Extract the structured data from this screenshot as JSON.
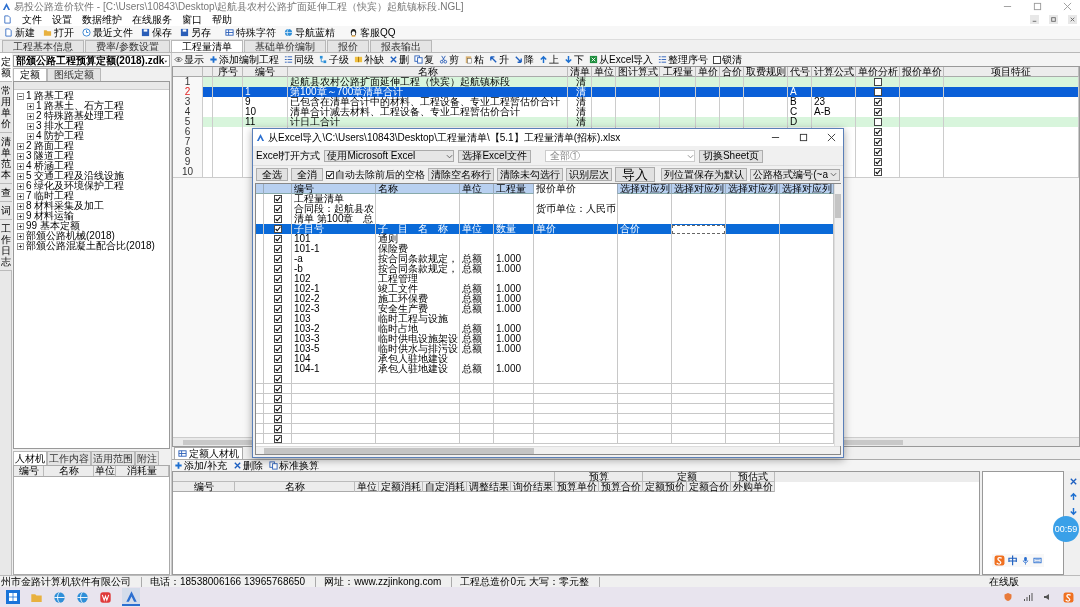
{
  "window": {
    "title": "易投公路造价软件 - [C:\\Users\\10843\\Desktop\\起航县农村公路扩面延伸工程（快宾）起航镇标段.NGL]"
  },
  "menu": [
    "文件",
    "设置",
    "数据维护",
    "在线服务",
    "窗口",
    "帮助"
  ],
  "toolbar": [
    "新建",
    "打开",
    "最近文件",
    "保存",
    "另存",
    "特殊字符",
    "导航蓝精",
    "客服QQ"
  ],
  "tabs": [
    {
      "label": "工程基本信息",
      "selected": false
    },
    {
      "label": "费率/参数设置",
      "selected": false
    },
    {
      "label": "工程量清单",
      "selected": true
    },
    {
      "label": "基础单价编制",
      "selected": false
    },
    {
      "label": "报价",
      "selected": false
    },
    {
      "label": "报表输出",
      "selected": false
    }
  ],
  "side_tabs": [
    {
      "label": "定额",
      "selected": true
    },
    {
      "label": "常用单价",
      "selected": false
    },
    {
      "label": "清单范本",
      "selected": false
    },
    {
      "label": "查",
      "selected": false
    },
    {
      "label": "词",
      "selected": false
    },
    {
      "label": "工作日志",
      "selected": false
    }
  ],
  "library": {
    "value": "部颁公路工程预算定额(2018).zdk",
    "tabs": [
      {
        "label": "定额",
        "selected": true
      },
      {
        "label": "图纸定额",
        "selected": false
      }
    ],
    "tree": [
      {
        "label": "1 路基工程",
        "expanded": true,
        "children": [
          {
            "label": "1 路基土、石方工程",
            "expanded": false
          },
          {
            "label": "2 特殊路基处理工程",
            "expanded": false
          },
          {
            "label": "3 排水工程",
            "expanded": false
          },
          {
            "label": "4 防护工程",
            "expanded": false
          }
        ]
      },
      {
        "label": "2 路面工程",
        "expanded": false
      },
      {
        "label": "3 隧道工程",
        "expanded": false
      },
      {
        "label": "4 桥涵工程",
        "expanded": false
      },
      {
        "label": "5 交通工程及沿线设施",
        "expanded": false
      },
      {
        "label": "6 绿化及环境保护工程",
        "expanded": false
      },
      {
        "label": "7 临时工程",
        "expanded": false
      },
      {
        "label": "8 材料采集及加工",
        "expanded": false
      },
      {
        "label": "9 材料运输",
        "expanded": false
      },
      {
        "label": "99 基本定额",
        "expanded": false
      },
      {
        "label": "部颁公路机械(2018)",
        "expanded": false
      },
      {
        "label": "部颁公路混凝土配合比(2018)",
        "expanded": false
      }
    ]
  },
  "materials": {
    "tabs": [
      {
        "label": "人材机",
        "selected": true
      },
      {
        "label": "工作内容",
        "selected": false
      },
      {
        "label": "适用范围",
        "selected": false
      },
      {
        "label": "附注",
        "selected": false
      }
    ],
    "columns": [
      "编号",
      "名称",
      "单位",
      "消耗量"
    ]
  },
  "bill": {
    "toolbar": [
      "显示",
      "添加编制工程",
      "同级",
      "子级",
      "补缺",
      "删",
      "复",
      "剪",
      "粘",
      "升",
      "降",
      "上",
      "下",
      "从Excel导入",
      "整理序号"
    ],
    "lock": {
      "label": "锁清",
      "checked": false
    },
    "columns": [
      "序号",
      "编号",
      "名称",
      "清单",
      "单位",
      "图计算式",
      "工程量",
      "单价",
      "合价",
      "取费规则",
      "代号",
      "计算公式",
      "单价分析",
      "报价单价",
      "项目特征"
    ],
    "rows": [
      {
        "number": "1",
        "name": "起航县农村公路扩面延伸工程（快宾）起航镇标段",
        "type": "清",
        "analysis": false,
        "selected": false,
        "highlighted": true
      },
      {
        "number": "2",
        "code": "1",
        "name": "第100章～700章清单合计",
        "type": "清",
        "symbol": "A",
        "analysis": false,
        "selected": true
      },
      {
        "number": "3",
        "code": "9",
        "name": "已包含在清单合计中的材料、工程设备、专业工程暂估价合计",
        "type": "清",
        "symbol": "B",
        "formula": "23",
        "analysis": true,
        "selected": false,
        "highlighted": false
      },
      {
        "number": "4",
        "code": "10",
        "name": "清单合计减去材料、工程设备、专业工程暂估价合计",
        "type": "清",
        "symbol": "C",
        "formula": "A-B",
        "analysis": true,
        "selected": false,
        "highlighted": false
      },
      {
        "number": "5",
        "code": "11",
        "name": "计日工合计",
        "type": "清",
        "symbol": "D",
        "analysis": false,
        "selected": false,
        "highlighted": true
      },
      {
        "number": "6",
        "analysis": true,
        "selected": false,
        "highlighted": false
      },
      {
        "number": "7",
        "analysis": true,
        "selected": false,
        "highlighted": false
      },
      {
        "number": "8",
        "analysis": true,
        "selected": false,
        "highlighted": false
      },
      {
        "number": "9",
        "analysis": true,
        "selected": false,
        "highlighted": false
      },
      {
        "number": "10",
        "analysis": true,
        "selected": false,
        "highlighted": false
      }
    ]
  },
  "dialog": {
    "title": "从Excel导入\\C:\\Users\\10843\\Desktop\\工程量清单\\【5.1】工程量清单(招标).xlsx",
    "open_label": "Excel打开方式",
    "open_mode": "使用Microsoft Excel",
    "choose_file": "选择Excel文件",
    "sheet": "全部①",
    "switch_sheet": "切换Sheet页",
    "select_all": "全选",
    "clear_all": "全消",
    "trim": {
      "label": "自动去除前后的空格",
      "checked": true
    },
    "actions": [
      "清除空名称行",
      "清除未勾选行",
      "识别层次"
    ],
    "import": "导入",
    "save_default": "列位置保存为默认",
    "format": "公路格式编号(~a",
    "columns": [
      "编号",
      "名称",
      "单位",
      "工程量",
      "报价单价",
      "选择对应列",
      "选择对应列",
      "选择对应列",
      "选择对应列"
    ],
    "rows": [
      {
        "checked": true,
        "selected": false,
        "editing": false,
        "code": "工程量清单"
      },
      {
        "checked": true,
        "selected": false,
        "editing": false,
        "code": "合同段：起航县农",
        "price": "货币单位：人民币"
      },
      {
        "checked": true,
        "selected": false,
        "editing": false,
        "code": "清单 第100章　总"
      },
      {
        "checked": true,
        "selected": true,
        "editing": true,
        "code": "子目号",
        "name": "子　目　名　称",
        "unit": "单位",
        "quantity": "数量",
        "price": "单价",
        "extra": "合价"
      },
      {
        "checked": true,
        "selected": false,
        "editing": false,
        "code": "101",
        "name": "通则"
      },
      {
        "checked": true,
        "selected": false,
        "editing": false,
        "code": "101-1",
        "name": "保险费"
      },
      {
        "checked": true,
        "selected": false,
        "editing": false,
        "code": "-a",
        "name": "按合同条款规定，",
        "unit": "总额",
        "quantity": "1.000"
      },
      {
        "checked": true,
        "selected": false,
        "editing": false,
        "code": "-b",
        "name": "按合同条款规定，",
        "unit": "总额",
        "quantity": "1.000"
      },
      {
        "checked": true,
        "selected": false,
        "editing": false,
        "code": "102",
        "name": "工程管理"
      },
      {
        "checked": true,
        "selected": false,
        "editing": false,
        "code": "102-1",
        "name": "竣工文件",
        "unit": "总额",
        "quantity": "1.000"
      },
      {
        "checked": true,
        "selected": false,
        "editing": false,
        "code": "102-2",
        "name": "施工环保费",
        "unit": "总额",
        "quantity": "1.000"
      },
      {
        "checked": true,
        "selected": false,
        "editing": false,
        "code": "102-3",
        "name": "安全生产费",
        "unit": "总额",
        "quantity": "1.000"
      },
      {
        "checked": true,
        "selected": false,
        "editing": false,
        "code": "103",
        "name": "临时工程与设施"
      },
      {
        "checked": true,
        "selected": false,
        "editing": false,
        "code": "103-2",
        "name": "临时占地",
        "unit": "总额",
        "quantity": "1.000"
      },
      {
        "checked": true,
        "selected": false,
        "editing": false,
        "code": "103-3",
        "name": "临时供电设施架设",
        "unit": "总额",
        "quantity": "1.000"
      },
      {
        "checked": true,
        "selected": false,
        "editing": false,
        "code": "103-5",
        "name": "临时供水与排污设",
        "unit": "总额",
        "quantity": "1.000"
      },
      {
        "checked": true,
        "selected": false,
        "editing": false,
        "code": "104",
        "name": "承包人驻地建设"
      },
      {
        "checked": true,
        "selected": false,
        "editing": false,
        "code": "104-1",
        "name": "承包人驻地建设",
        "unit": "总额",
        "quantity": "1.000"
      },
      {
        "checked": true,
        "selected": false,
        "editing": false
      },
      {
        "checked": true,
        "selected": false,
        "editing": false
      },
      {
        "checked": true,
        "selected": false,
        "editing": false
      },
      {
        "checked": true,
        "selected": false,
        "editing": false
      },
      {
        "checked": true,
        "selected": false,
        "editing": false
      },
      {
        "checked": true,
        "selected": false,
        "editing": false
      },
      {
        "checked": true,
        "selected": false,
        "editing": false
      }
    ]
  },
  "quota": {
    "tabs": [
      {
        "label": "定额人材机",
        "selected": true
      }
    ],
    "toolbar": [
      "添加/补充",
      "删除",
      "标准换算"
    ],
    "groups": [
      "预算",
      "定额",
      "预估式"
    ],
    "columns": [
      "编号",
      "名称",
      "单位",
      "定额消耗",
      "自定消耗",
      "调整结果",
      "询价结果",
      "预算单价",
      "预算合价",
      "定额预价",
      "定额合价",
      "外购单价"
    ]
  },
  "overlay": {
    "timer": "00:59",
    "ime": "中"
  },
  "status_bar": [
    "州市金路计算机软件有限公司",
    "电话：18538006166  13965768650",
    "网址：www.zzjinkong.com",
    "工程总造价0元 大写：零元整",
    "在线版"
  ]
}
